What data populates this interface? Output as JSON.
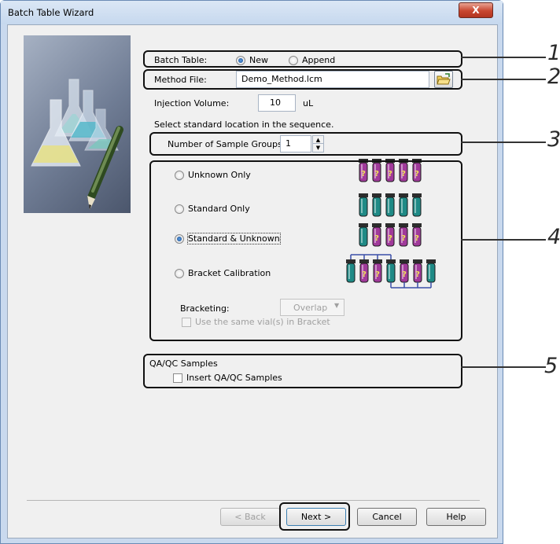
{
  "window": {
    "title": "Batch Table Wizard",
    "close_label": "X"
  },
  "batch_table": {
    "label": "Batch Table:",
    "new_label": "New",
    "append_label": "Append"
  },
  "method_file": {
    "label": "Method File:",
    "value": "Demo_Method.lcm"
  },
  "injection_volume": {
    "label": "Injection Volume:",
    "value": "10",
    "unit": "uL"
  },
  "instruction": "Select standard location in the sequence.",
  "sample_groups": {
    "label": "Number of Sample Groups:",
    "value": "1"
  },
  "options": {
    "unknown_only": "Unknown Only",
    "standard_only": "Standard Only",
    "standard_unknown": "Standard & Unknown",
    "bracket_calibration": "Bracket Calibration"
  },
  "bracketing": {
    "label": "Bracketing:",
    "value": "Overlap",
    "same_vial_label": "Use the same vial(s) in Bracket"
  },
  "qaqc": {
    "title": "QA/QC Samples",
    "insert_label": "Insert QA/QC Samples"
  },
  "buttons": {
    "back": "< Back",
    "next": "Next >",
    "cancel": "Cancel",
    "help": "Help"
  },
  "callouts": [
    "1",
    "2",
    "3",
    "4",
    "5"
  ],
  "colors": {
    "standard_vial": "#1f8a86",
    "unknown_vial": "#a03a9a",
    "connector": "#3a4fa8"
  }
}
